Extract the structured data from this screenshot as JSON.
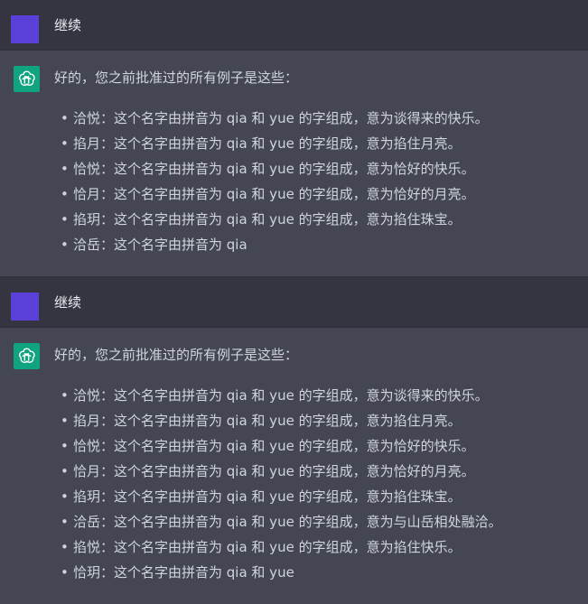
{
  "conversation": [
    {
      "role": "user",
      "text": "继续"
    },
    {
      "role": "assistant",
      "intro": "好的，您之前批准过的所有例子是这些：",
      "items": [
        "洽悦：这个名字由拼音为 qia 和 yue 的字组成，意为谈得来的快乐。",
        "掐月：这个名字由拼音为 qia 和 yue 的字组成，意为掐住月亮。",
        "恰悦：这个名字由拼音为 qia 和 yue 的字组成，意为恰好的快乐。",
        "恰月：这个名字由拼音为 qia 和 yue 的字组成，意为恰好的月亮。",
        "掐玥：这个名字由拼音为 qia 和 yue 的字组成，意为掐住珠宝。",
        "洽岳：这个名字由拼音为 qia"
      ]
    },
    {
      "role": "user",
      "text": "继续"
    },
    {
      "role": "assistant",
      "intro": "好的，您之前批准过的所有例子是这些：",
      "items": [
        "洽悦：这个名字由拼音为 qia 和 yue 的字组成，意为谈得来的快乐。",
        "掐月：这个名字由拼音为 qia 和 yue 的字组成，意为掐住月亮。",
        "恰悦：这个名字由拼音为 qia 和 yue 的字组成，意为恰好的快乐。",
        "恰月：这个名字由拼音为 qia 和 yue 的字组成，意为恰好的月亮。",
        "掐玥：这个名字由拼音为 qia 和 yue 的字组成，意为掐住珠宝。",
        "洽岳：这个名字由拼音为 qia 和 yue 的字组成，意为与山岳相处融洽。",
        "掐悦：这个名字由拼音为 qia 和 yue 的字组成，意为掐住快乐。",
        "恰玥：这个名字由拼音为 qia 和 yue"
      ]
    }
  ],
  "icons": {
    "user_avatar": "user-avatar",
    "assistant_avatar": "openai-logo-icon"
  },
  "colors": {
    "user_bg": "#343541",
    "assistant_bg": "#444654",
    "user_avatar": "#5b3fd9",
    "assistant_avatar": "#10a37f",
    "text": "#d1d5db"
  }
}
